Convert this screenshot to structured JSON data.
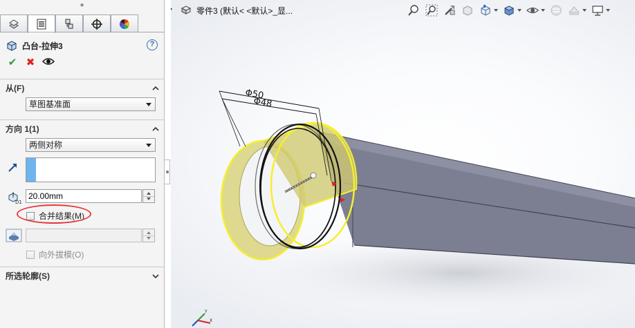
{
  "panel": {
    "grip_glyph": "●",
    "tabs": [
      {
        "id": "feature-manager",
        "icon": "feature-tree-icon"
      },
      {
        "id": "property-manager",
        "icon": "property-manager-icon"
      },
      {
        "id": "configuration-manager",
        "icon": "configuration-manager-icon"
      },
      {
        "id": "dimxpert-manager",
        "icon": "dimxpert-icon"
      },
      {
        "id": "display-manager",
        "icon": "display-manager-icon"
      }
    ],
    "active_tab": "property-manager",
    "feature_title": "凸台-拉伸3",
    "help_glyph": "?",
    "ok_glyph": "✔",
    "cancel_glyph": "✖",
    "preview_icon": "eye-icon",
    "from": {
      "label": "从(F)",
      "value": "草图基准面"
    },
    "direction1": {
      "label": "方向 1(1)",
      "end_condition": "两侧对称",
      "depth": "20.00mm",
      "merge_label": "合并结果(M)",
      "merge_checked": false,
      "draft_outward_label": "向外拔模(O)"
    },
    "selected_contours": {
      "label": "所选轮廓(S)"
    }
  },
  "graphics": {
    "tree_label": "零件3  (默认< <默认>_显...",
    "heads_up_icons": [
      "zoom-to-fit-icon",
      "zoom-area-icon",
      "previous-view-icon",
      "section-view-icon",
      "view-orientation-icon",
      "display-style-icon",
      "hide-show-icon",
      "edit-appearance-icon",
      "apply-scene-icon",
      "view-settings-icon"
    ],
    "dimension_outer": "50",
    "dimension_inner": "48",
    "diameter_symbol": "Φ",
    "colors": {
      "body": "#7b7d8f",
      "body_dark": "#5e6070",
      "preview_fill": "#d8d27a",
      "preview_edge": "#f2ee3a",
      "highlight": "#e43a3a"
    }
  }
}
